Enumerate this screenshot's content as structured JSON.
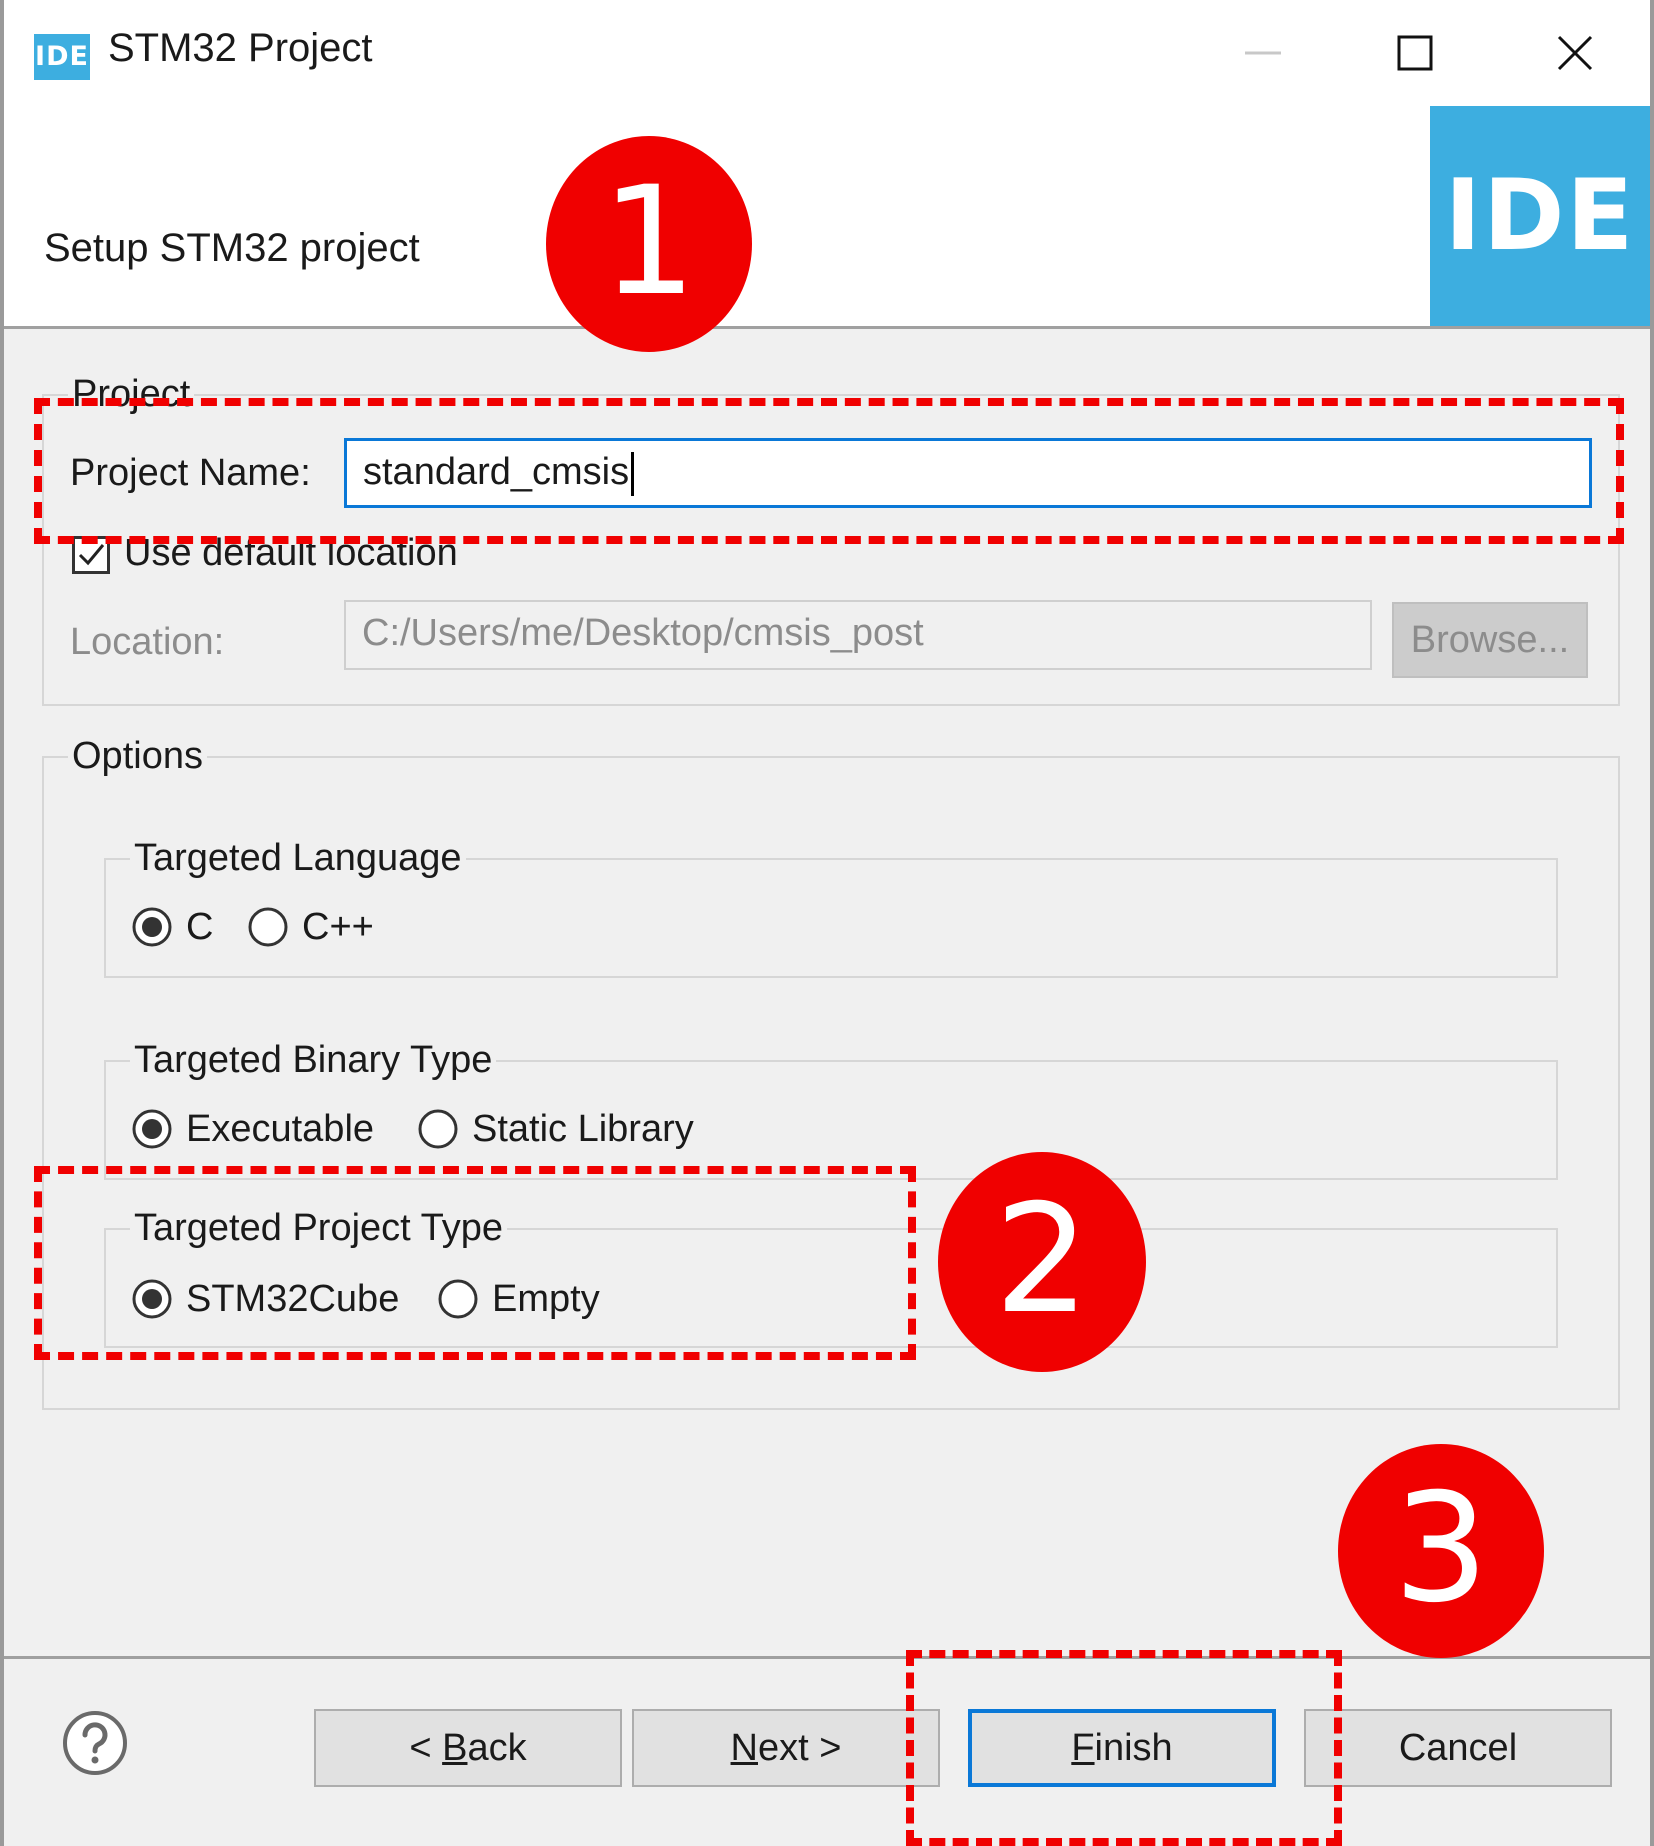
{
  "window": {
    "app_icon_text": "IDE",
    "title": "STM32 Project",
    "controls": {
      "minimize": "minimize-icon",
      "maximize": "maximize-icon",
      "close": "close-icon"
    }
  },
  "header": {
    "title": "Setup STM32 project",
    "banner_text": "IDE"
  },
  "project_group": {
    "legend": "Project",
    "name_label": "Project Name:",
    "name_value": "standard_cmsis",
    "use_default_location_label": "Use default location",
    "use_default_location_checked": true,
    "location_label": "Location:",
    "location_value": "C:/Users/me/Desktop/cmsis_post",
    "browse_label": "Browse..."
  },
  "options_group": {
    "legend": "Options",
    "language": {
      "legend": "Targeted Language",
      "options": [
        {
          "label": "C",
          "selected": true
        },
        {
          "label": "C++",
          "selected": false
        }
      ]
    },
    "binary_type": {
      "legend": "Targeted Binary Type",
      "options": [
        {
          "label": "Executable",
          "selected": true
        },
        {
          "label": "Static Library",
          "selected": false
        }
      ]
    },
    "project_type": {
      "legend": "Targeted Project Type",
      "options": [
        {
          "label": "STM32Cube",
          "selected": true
        },
        {
          "label": "Empty",
          "selected": false
        }
      ]
    }
  },
  "footer": {
    "help_icon": "help-icon",
    "back": {
      "prefix": "< ",
      "mnemonic": "B",
      "rest": "ack"
    },
    "next": {
      "mnemonic": "N",
      "rest": "ext >"
    },
    "finish": {
      "mnemonic": "F",
      "rest": "inish"
    },
    "cancel": "Cancel"
  },
  "annotations": {
    "badge_1": "1",
    "badge_2": "2",
    "badge_3": "3",
    "highlight_color": "#f00000"
  },
  "colors": {
    "accent": "#0a78d7",
    "brand": "#3daee0",
    "dialog_bg": "#f0f0f0"
  }
}
